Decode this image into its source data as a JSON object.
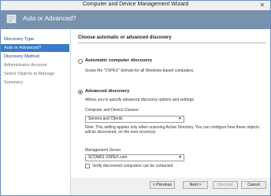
{
  "window": {
    "title": "Computer and Device Management Wizard",
    "close_glyph": "✕"
  },
  "banner": {
    "title": "Auto or Advanced?",
    "icon": "wizard-page-icon"
  },
  "sidebar": {
    "items": [
      {
        "label": "Discovery Type",
        "state": "done"
      },
      {
        "label": "Auto or Advanced?",
        "state": "current"
      },
      {
        "label": "Discovery Method",
        "state": "done"
      },
      {
        "label": "Administrator Account",
        "state": "pending"
      },
      {
        "label": "Select Objects to Manage",
        "state": "pending"
      },
      {
        "label": "Summary",
        "state": "pending"
      }
    ]
  },
  "main": {
    "heading": "Choose automatic or advanced discovery",
    "automatic": {
      "label": "Automatic computer discovery",
      "description": "Scans the \"VSPEX\" domain for all Windows-based computers.",
      "selected": false
    },
    "advanced": {
      "label": "Advanced discovery",
      "description": "Allows you to specify advanced discovery options and settings.",
      "selected": true
    },
    "classes": {
      "label": "Computer and Device Classes:",
      "value": "Servers and Clients"
    },
    "note": "Note: This setting applies only when scanning Active Directory. You can configure how these objects will be discovered, on the next screen(s).",
    "management_server": {
      "label": "Management Server",
      "value": "SCOM01.VSPEX.com"
    },
    "verify": {
      "label": "Verify discovered computers can be contacted",
      "checked": false
    }
  },
  "footer": {
    "previous": "< Previous",
    "next": "Next >",
    "discover": "Discover",
    "cancel": "Cancel"
  }
}
